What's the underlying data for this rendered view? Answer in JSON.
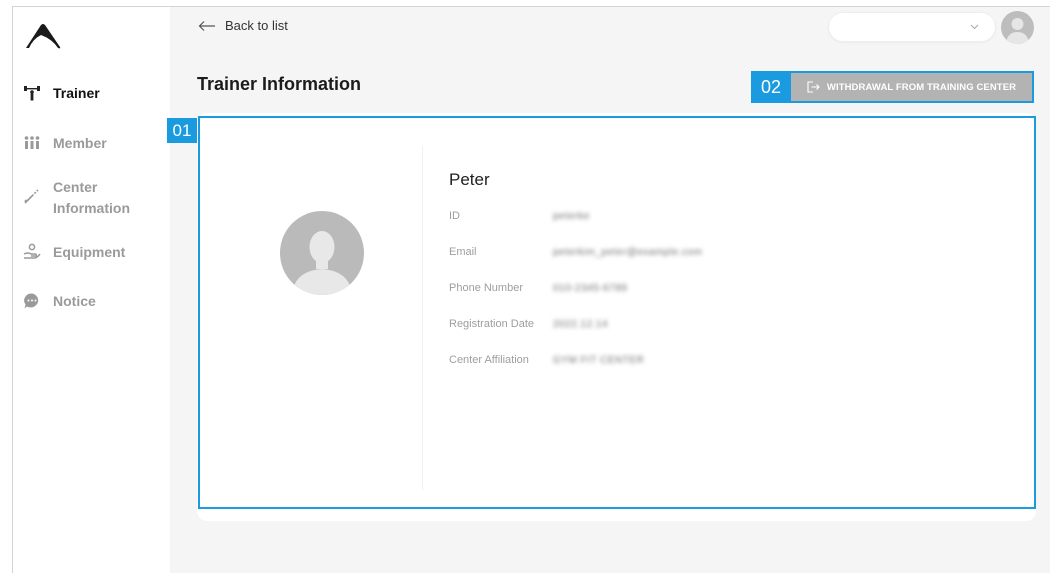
{
  "sidebar": {
    "items": [
      {
        "label": "Trainer",
        "icon": "dumbbell-icon",
        "active": true
      },
      {
        "label": "Member",
        "icon": "members-icon",
        "active": false
      },
      {
        "label": "Center\nInformation",
        "icon": "tools-icon",
        "active": false
      },
      {
        "label": "Equipment",
        "icon": "hand-equipment-icon",
        "active": false
      },
      {
        "label": "Notice",
        "icon": "chat-bubble-icon",
        "active": false
      }
    ]
  },
  "header": {
    "back_label": "Back to list",
    "select_value": ""
  },
  "page": {
    "title": "Trainer Information",
    "withdraw_label": "WITHDRAWAL FROM TRAINING CENTER",
    "markers": {
      "card": "01",
      "withdraw": "02"
    }
  },
  "trainer": {
    "name": "Peter",
    "fields": [
      {
        "label": "ID",
        "value": "peterke"
      },
      {
        "label": "Email",
        "value": "peterkim_peter@example.com"
      },
      {
        "label": "Phone Number",
        "value": "010-2345-6789"
      },
      {
        "label": "Registration Date",
        "value": "2022.12.14"
      },
      {
        "label": "Center Affiliation",
        "value": "GYM FIT CENTER"
      }
    ]
  },
  "colors": {
    "accent": "#1a9be0",
    "button_gray": "#b3b3b3",
    "sidebar_inactive": "#9a9a9a"
  }
}
